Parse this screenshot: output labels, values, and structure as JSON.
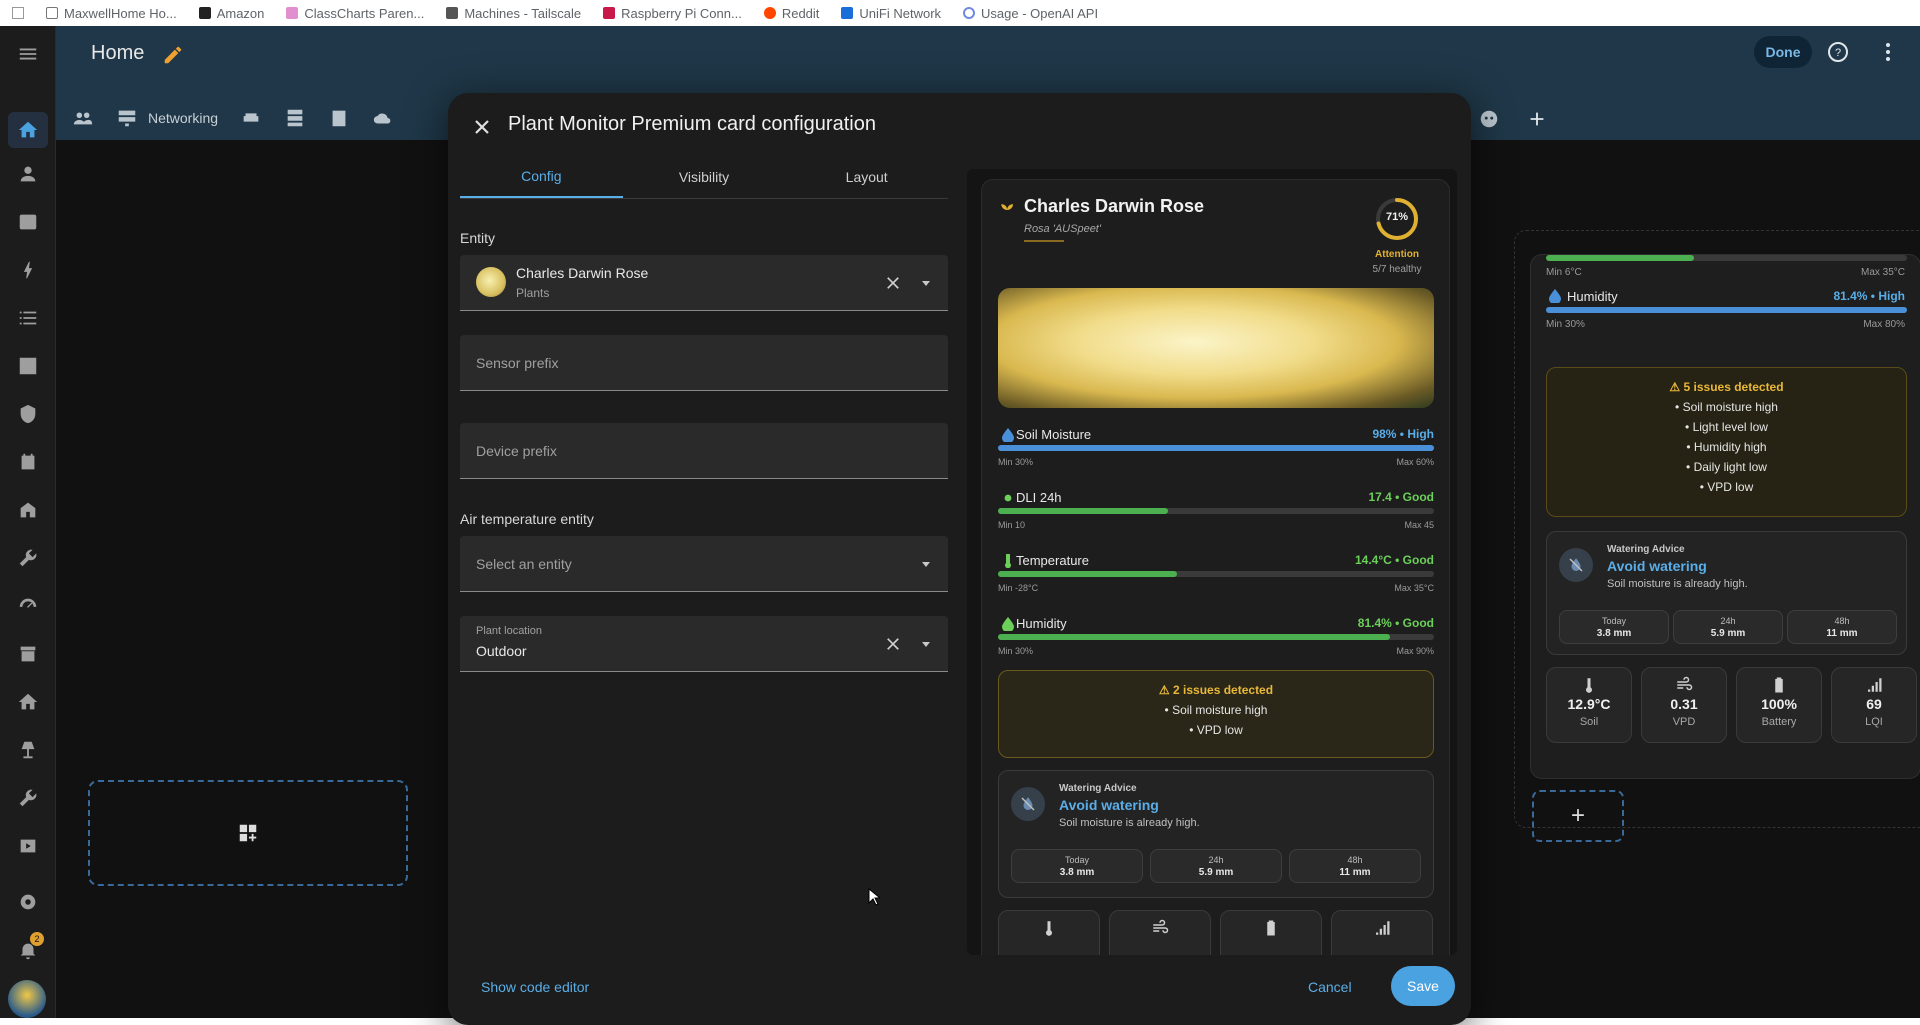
{
  "bookmarks": [
    "MaxwellHome Ho...",
    "Amazon",
    "ClassCharts Paren...",
    "Machines - Tailscale",
    "Raspberry Pi Conn...",
    "Reddit",
    "UniFi Network",
    "Usage - OpenAI API"
  ],
  "header": {
    "title": "Home",
    "done_label": "Done",
    "networking_label": "Networking"
  },
  "dialog": {
    "title": "Plant Monitor Premium card configuration",
    "tabs": [
      "Config",
      "Visibility",
      "Layout"
    ],
    "entity_label": "Entity",
    "entity_value": "Charles Darwin Rose",
    "entity_sub": "Plants",
    "sensor_prefix_placeholder": "Sensor prefix",
    "device_prefix_placeholder": "Device prefix",
    "air_temp_label": "Air temperature entity",
    "air_temp_placeholder": "Select an entity",
    "plant_location_label": "Plant location",
    "plant_location_value": "Outdoor",
    "show_code_editor": "Show code editor",
    "cancel": "Cancel",
    "save": "Save"
  },
  "preview": {
    "name": "Charles Darwin Rose",
    "scientific": "Rosa 'AUSpeet'",
    "health_pct": "71%",
    "health_fraction": 0.71,
    "status": "Attention",
    "healthy": "5/7 healthy",
    "metrics": [
      {
        "name": "Soil Moisture",
        "value": "98% • High",
        "min": "Min 30%",
        "max": "Max 60%",
        "fill": 1.0,
        "color": "#4a90d9",
        "valcolor": "#5aaee8"
      },
      {
        "name": "DLI 24h",
        "value": "17.4 • Good",
        "min": "Min 10",
        "max": "Max 45",
        "fill": 0.39,
        "color": "#4caf50",
        "valcolor": "#6ccf5a"
      },
      {
        "name": "Temperature",
        "value": "14.4°C • Good",
        "min": "Min -28°C",
        "max": "Max 35°C",
        "fill": 0.41,
        "color": "#4caf50",
        "valcolor": "#6ccf5a"
      },
      {
        "name": "Humidity",
        "value": "81.4% • Good",
        "min": "Min 30%",
        "max": "Max 90%",
        "fill": 0.9,
        "color": "#4caf50",
        "valcolor": "#6ccf5a"
      }
    ],
    "issues_title": "2 issues detected",
    "issues": [
      "• Soil moisture high",
      "• VPD low"
    ],
    "advice_kicker": "Watering Advice",
    "advice_title": "Avoid watering",
    "advice_sub": "Soil moisture is already high.",
    "rain": [
      {
        "label": "Today",
        "value": "3.8 mm"
      },
      {
        "label": "24h",
        "value": "5.9 mm"
      },
      {
        "label": "48h",
        "value": "11 mm"
      }
    ]
  },
  "right_card": {
    "temp_min": "Min 6°C",
    "temp_max": "Max 35°C",
    "humidity_name": "Humidity",
    "humidity_value": "81.4% • High",
    "humidity_min": "Min 30%",
    "humidity_max": "Max 80%",
    "humidity_fill": 1.0,
    "temp_fill": 0.41,
    "issues_title": "5 issues detected",
    "issues": [
      "• Soil moisture high",
      "• Light level low",
      "• Humidity high",
      "• Daily light low",
      "• VPD low"
    ],
    "advice_kicker": "Watering Advice",
    "advice_title": "Avoid watering",
    "advice_sub": "Soil moisture is already high.",
    "rain": [
      {
        "label": "Today",
        "value": "3.8 mm"
      },
      {
        "label": "24h",
        "value": "5.9 mm"
      },
      {
        "label": "48h",
        "value": "11 mm"
      }
    ],
    "stats": [
      {
        "value": "12.9°C",
        "label": "Soil"
      },
      {
        "value": "0.31",
        "label": "VPD"
      },
      {
        "value": "100%",
        "label": "Battery"
      },
      {
        "value": "69",
        "label": "LQI"
      }
    ]
  },
  "notifications_count": "2",
  "colors": {
    "accent": "#5aaee8",
    "topbar": "#1f3748",
    "warning": "#e8b838",
    "good": "#6ccf5a"
  }
}
